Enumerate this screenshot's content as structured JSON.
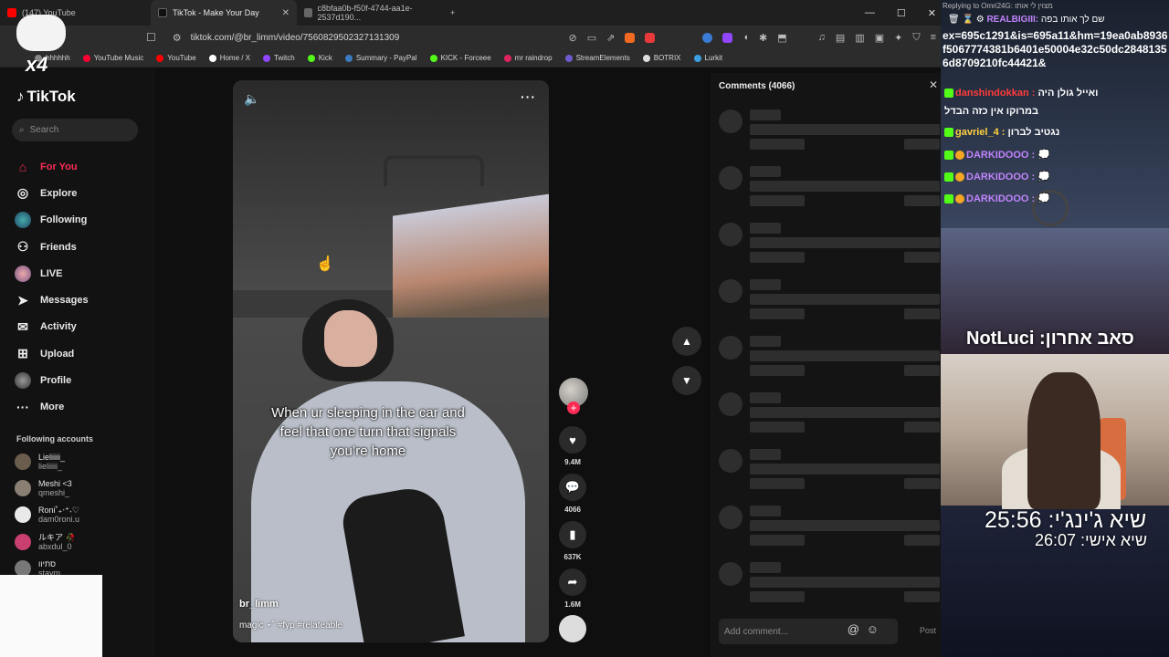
{
  "browser": {
    "tabs": [
      {
        "label": "(147) YouTube",
        "fav_color": "#ff0000",
        "active": false
      },
      {
        "label": "TikTok - Make Your Day",
        "fav_color": "#111111",
        "active": true
      },
      {
        "label": "c8bfaa0b-f50f-4744-aa1e-2537d190...",
        "fav_color": "#666666",
        "active": false
      }
    ],
    "new_tab": "+",
    "window_controls": [
      "—",
      "☐",
      "✕"
    ],
    "url": "tiktok.com/@br_limm/video/7560829502327131309",
    "bookmarks": [
      {
        "label": "bhhhhh",
        "color": "#888888"
      },
      {
        "label": "YouTube Music",
        "color": "#ff0033"
      },
      {
        "label": "YouTube",
        "color": "#ff0000"
      },
      {
        "label": "Home / X",
        "color": "#ffffff"
      },
      {
        "label": "Twitch",
        "color": "#9146ff"
      },
      {
        "label": "Kick",
        "color": "#53fc18"
      },
      {
        "label": "Summary - PayPal",
        "color": "#3b7bbf"
      },
      {
        "label": "KICK - Forceee",
        "color": "#53fc18"
      },
      {
        "label": "mr raindrop",
        "color": "#e0245e"
      },
      {
        "label": "StreamElements",
        "color": "#6d5bd0"
      },
      {
        "label": "BOTRIX",
        "color": "#dddddd"
      },
      {
        "label": "Lurkit",
        "color": "#3aa0e0"
      }
    ]
  },
  "tiktok": {
    "logo": "TikTok",
    "search_placeholder": "Search",
    "nav": [
      {
        "label": "For You",
        "icon": "home-icon",
        "glyph": "⌂",
        "active": true
      },
      {
        "label": "Explore",
        "icon": "compass-icon",
        "glyph": "◎",
        "active": false
      },
      {
        "label": "Following",
        "icon": "following-icon",
        "glyph": "●",
        "active": false
      },
      {
        "label": "Friends",
        "icon": "friends-icon",
        "glyph": "👥",
        "active": false
      },
      {
        "label": "LIVE",
        "icon": "live-icon",
        "glyph": "●",
        "active": false
      },
      {
        "label": "Messages",
        "icon": "messages-icon",
        "glyph": "➤",
        "active": false
      },
      {
        "label": "Activity",
        "icon": "activity-icon",
        "glyph": "♡",
        "active": false
      },
      {
        "label": "Upload",
        "icon": "upload-icon",
        "glyph": "⊞",
        "active": false
      },
      {
        "label": "Profile",
        "icon": "profile-icon",
        "glyph": "●",
        "active": false
      },
      {
        "label": "More",
        "icon": "more-icon",
        "glyph": "···",
        "active": false
      }
    ],
    "following_title": "Following accounts",
    "accounts": [
      {
        "name": "Lieliiiii_",
        "handle": "lieliiiii_",
        "color": "#6b5d4d"
      },
      {
        "name": "Meshi <3",
        "handle": "qmeshi_",
        "color": "#8a7f73"
      },
      {
        "name": "Roni˚₊‧⁺˖♡",
        "handle": "dam0roni.u",
        "color": "#e9e9e9"
      },
      {
        "name": "ルキア 🥀",
        "handle": "abxdul_0",
        "color": "#c94070"
      },
      {
        "name": "סתיוו",
        "handle": "staym...",
        "color": "#777777"
      }
    ]
  },
  "video": {
    "caption": "When ur sleeping in the car and feel that one turn that signals you’re home",
    "username": "br_limm",
    "description": "magic ⋆˚ #fyp #relateable",
    "likes": "9.4M",
    "comments": "4066",
    "saves": "637K",
    "shares": "1.6M"
  },
  "comments_panel": {
    "title": "Comments (4066)",
    "placeholder": "Add comment...",
    "post_label": "Post",
    "skeleton_count": 9
  },
  "stream_overlay": {
    "reply_header": "Replying to Omri24G: מצוין לי אותו",
    "hash_text": "ex=695c1291&is=695a11&hm=19ea0ab8936f5067774381b6401e50004e32c50dc28481356d8709210fc44421&",
    "chat": [
      {
        "user": "REALBIGIII:",
        "text": "שם לך אותו בפה",
        "color": "#c084fc"
      },
      {
        "user": "danshindokkan :",
        "text": "ואייל גולן היה",
        "color": "#ff3b3b"
      },
      {
        "user": "",
        "text": "במרוקו אין כזה הבדל",
        "color": "#ffffff"
      },
      {
        "user": "gavriel_4 :",
        "text": "נגטיב לברון",
        "color": "#ffd23f"
      },
      {
        "user": "DARKIDOOO :",
        "text": "💭",
        "color": "#c084fc"
      },
      {
        "user": "DARKIDOOO :",
        "text": "💭",
        "color": "#c084fc"
      },
      {
        "user": "DARKIDOOO :",
        "text": "💭",
        "color": "#c084fc"
      }
    ],
    "title": "NotLuci :סאב אחרון",
    "timer_main": "שיא ג'ינג'י: 25:56",
    "timer_personal": "שיא אישי: 26:07",
    "multiplier": "x4"
  }
}
